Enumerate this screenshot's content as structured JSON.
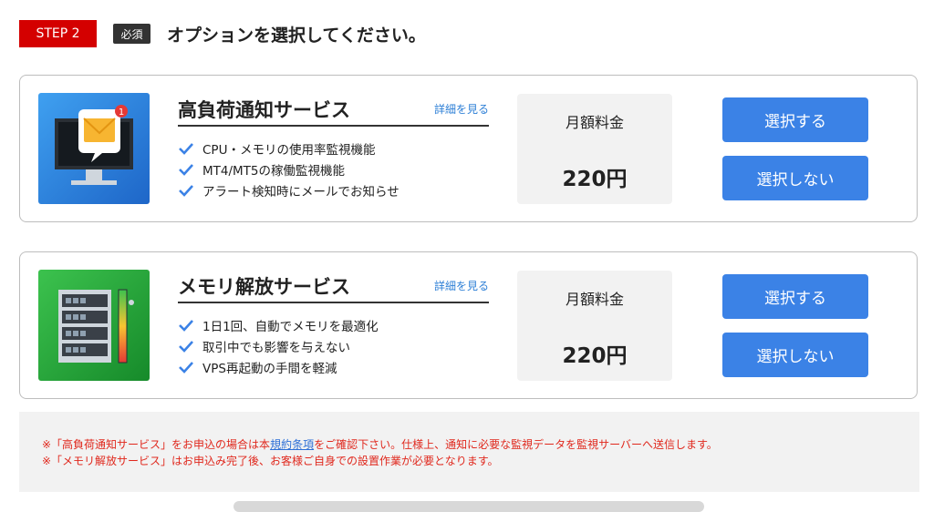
{
  "header": {
    "step": "STEP 2",
    "required": "必須",
    "title": "オプションを選択してください。"
  },
  "services": [
    {
      "title": "高負荷通知サービス",
      "details_link": "詳細を見る",
      "features": [
        "CPU・メモリの使用率監視機能",
        "MT4/MT5の稼働監視機能",
        "アラート検知時にメールでお知らせ"
      ],
      "price_label": "月額料金",
      "price": "220円",
      "select_label": "選択する",
      "deselect_label": "選択しない",
      "icon": "monitor-mail-notification-icon",
      "notification_count": "1"
    },
    {
      "title": "メモリ解放サービス",
      "details_link": "詳細を見る",
      "features": [
        "1日1回、自動でメモリを最適化",
        "取引中でも影響を与えない",
        "VPS再起動の手間を軽減"
      ],
      "price_label": "月額料金",
      "price": "220円",
      "select_label": "選択する",
      "deselect_label": "選択しない",
      "icon": "server-rack-memory-gauge-icon"
    }
  ],
  "notes": {
    "line1_prefix": "※「高負荷通知サービス」をお申込の場合は本",
    "line1_link": "規約条項",
    "line1_suffix": "をご確認下さい。仕様上、通知に必要な監視データを監視サーバーへ送信します。",
    "line2": "※「メモリ解放サービス」はお申込み完了後、お客様ご自身での設置作業が必要となります。"
  },
  "colors": {
    "step_badge": "#d40000",
    "required_badge": "#333333",
    "button": "#3b82e6",
    "link": "#2d7fd6",
    "note_text": "#e0281d",
    "check": "#3b82e6"
  }
}
